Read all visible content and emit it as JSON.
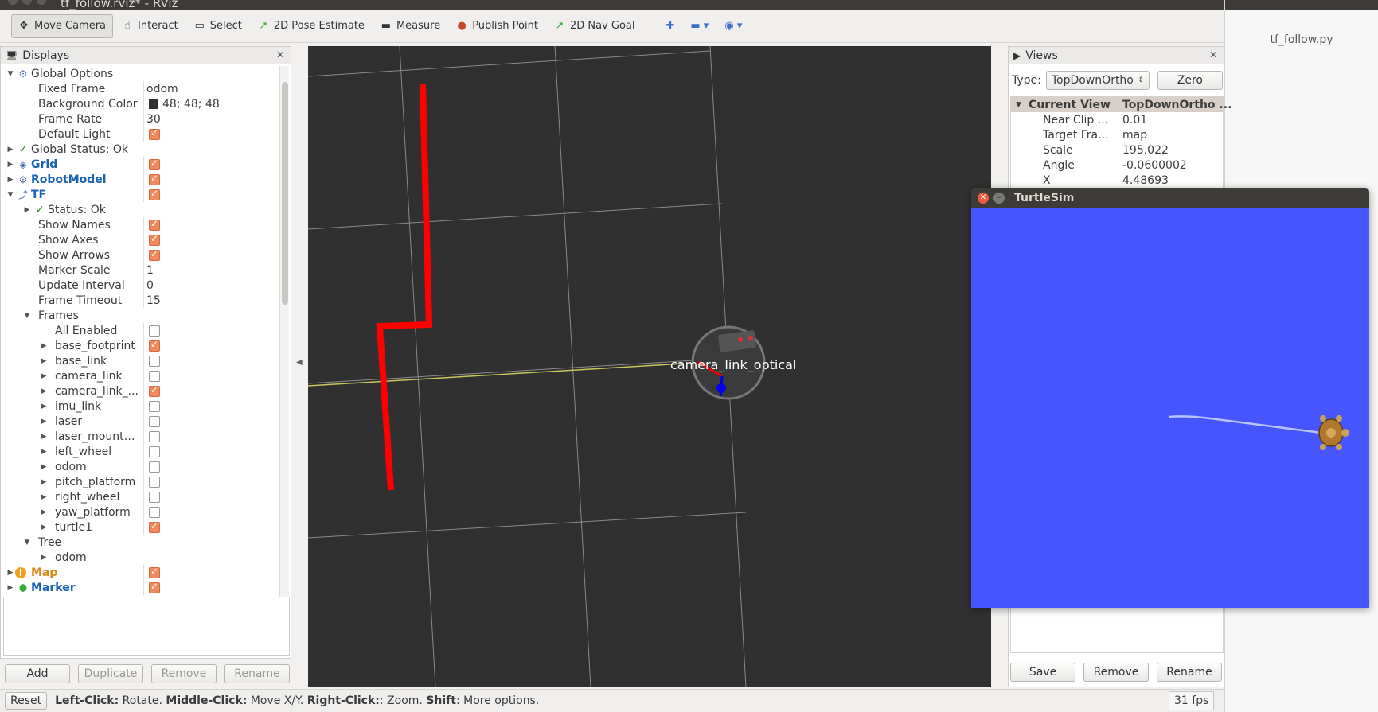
{
  "window": {
    "title": "tf_follow.rviz* - RViz"
  },
  "editor": {
    "tab": "tf_follow.py"
  },
  "toolbar": {
    "tools": [
      {
        "label": "Move Camera",
        "icon": "move-camera-icon",
        "glyph": "✥",
        "active": true
      },
      {
        "label": "Interact",
        "icon": "hand-icon",
        "glyph": "☝"
      },
      {
        "label": "Select",
        "icon": "select-box-icon",
        "glyph": "▭"
      },
      {
        "label": "2D Pose Estimate",
        "icon": "pose-arrow-icon",
        "glyph": "↗"
      },
      {
        "label": "Measure",
        "icon": "ruler-icon",
        "glyph": "▬"
      },
      {
        "label": "Publish Point",
        "icon": "location-pin-icon",
        "glyph": "●"
      },
      {
        "label": "2D Nav Goal",
        "icon": "nav-arrow-icon",
        "glyph": "↗"
      }
    ],
    "extra_icons": [
      "plus-icon",
      "minus-icon",
      "eye-icon"
    ]
  },
  "displays": {
    "title": "Displays",
    "rows": [
      {
        "indent": 0,
        "arrow": "▼",
        "icon": "⚙",
        "name": "Global Options"
      },
      {
        "indent": 1,
        "name": "Fixed Frame",
        "value": "odom"
      },
      {
        "indent": 1,
        "name": "Background Color",
        "value": "48; 48; 48",
        "swatch": true
      },
      {
        "indent": 1,
        "name": "Frame Rate",
        "value": "30"
      },
      {
        "indent": 1,
        "name": "Default Light",
        "check": true
      },
      {
        "indent": 0,
        "arrow": "▶",
        "tick": true,
        "name": "Global Status: Ok"
      },
      {
        "indent": 0,
        "arrow": "▶",
        "icon": "◈",
        "name": "Grid",
        "style": "blue",
        "check": true
      },
      {
        "indent": 0,
        "arrow": "▶",
        "icon": "⚙",
        "name": "RobotModel",
        "style": "blue",
        "check": true
      },
      {
        "indent": 0,
        "arrow": "▼",
        "icon": "⤴",
        "name": "TF",
        "style": "blue",
        "check": true
      },
      {
        "indent": 1,
        "arrow": "▶",
        "tick": true,
        "name": "Status: Ok"
      },
      {
        "indent": 1,
        "name": "Show Names",
        "check": true
      },
      {
        "indent": 1,
        "name": "Show Axes",
        "check": true
      },
      {
        "indent": 1,
        "name": "Show Arrows",
        "check": true
      },
      {
        "indent": 1,
        "name": "Marker Scale",
        "value": "1"
      },
      {
        "indent": 1,
        "name": "Update Interval",
        "value": "0"
      },
      {
        "indent": 1,
        "name": "Frame Timeout",
        "value": "15"
      },
      {
        "indent": 1,
        "arrow": "▼",
        "name": "Frames"
      },
      {
        "indent": 2,
        "name": "All Enabled",
        "check": false
      },
      {
        "indent": 2,
        "arrow": "▶",
        "name": "base_footprint",
        "check": true
      },
      {
        "indent": 2,
        "arrow": "▶",
        "name": "base_link",
        "check": false
      },
      {
        "indent": 2,
        "arrow": "▶",
        "name": "camera_link",
        "check": false
      },
      {
        "indent": 2,
        "arrow": "▶",
        "name": "camera_link_...",
        "check": true
      },
      {
        "indent": 2,
        "arrow": "▶",
        "name": "imu_link",
        "check": false
      },
      {
        "indent": 2,
        "arrow": "▶",
        "name": "laser",
        "check": false
      },
      {
        "indent": 2,
        "arrow": "▶",
        "name": "laser_mount…",
        "check": false
      },
      {
        "indent": 2,
        "arrow": "▶",
        "name": "left_wheel",
        "check": false
      },
      {
        "indent": 2,
        "arrow": "▶",
        "name": "odom",
        "check": false
      },
      {
        "indent": 2,
        "arrow": "▶",
        "name": "pitch_platform",
        "check": false
      },
      {
        "indent": 2,
        "arrow": "▶",
        "name": "right_wheel",
        "check": false
      },
      {
        "indent": 2,
        "arrow": "▶",
        "name": "yaw_platform",
        "check": false
      },
      {
        "indent": 2,
        "arrow": "▶",
        "name": "turtle1",
        "check": true
      },
      {
        "indent": 1,
        "arrow": "▼",
        "name": "Tree"
      },
      {
        "indent": 2,
        "arrow": "▶",
        "name": "odom"
      },
      {
        "indent": 0,
        "arrow": "▶",
        "icon": "!",
        "name": "Map",
        "style": "orange",
        "check": true
      },
      {
        "indent": 0,
        "arrow": "▶",
        "icon": "⬢",
        "name": "Marker",
        "style": "blue",
        "check": true
      }
    ],
    "buttons": {
      "add": "Add",
      "duplicate": "Duplicate",
      "remove": "Remove",
      "rename": "Rename"
    }
  },
  "viewport": {
    "frame_label": "camera_link_optical"
  },
  "views": {
    "title": "Views",
    "type_label": "Type:",
    "type_value": "TopDownOrtho",
    "zero": "Zero",
    "header": {
      "k": "Current View",
      "v": "TopDownOrtho ..."
    },
    "rows": [
      {
        "k": "Near Clip ...",
        "v": "0.01"
      },
      {
        "k": "Target Fra...",
        "v": "map"
      },
      {
        "k": "Scale",
        "v": "195.022"
      },
      {
        "k": "Angle",
        "v": "-0.0600002"
      },
      {
        "k": "X",
        "v": "4.48693"
      }
    ],
    "buttons": {
      "save": "Save",
      "remove": "Remove",
      "rename": "Rename"
    }
  },
  "turtlesim": {
    "title": "TurtleSim",
    "bg": "#4556ff"
  },
  "statusbar": {
    "reset": "Reset",
    "hint_left_key": "Left-Click:",
    "hint_left": " Rotate. ",
    "hint_mid_key": "Middle-Click:",
    "hint_mid": " Move X/Y. ",
    "hint_right_key": "Right-Click:",
    "hint_right": ": Zoom. ",
    "hint_shift_key": "Shift",
    "hint_shift": ": More options.",
    "fps": "31 fps"
  }
}
